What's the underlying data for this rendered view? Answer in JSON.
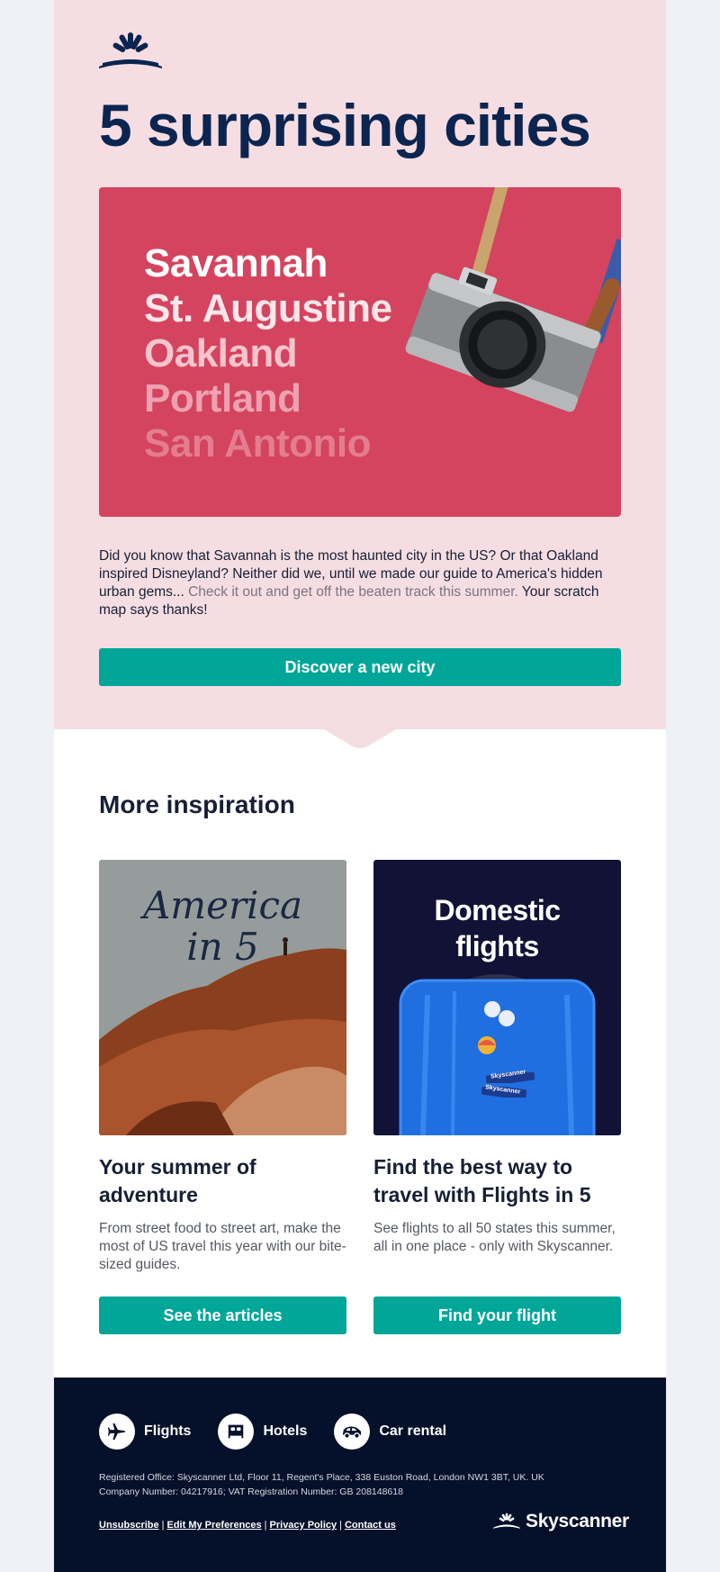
{
  "hero": {
    "headline": "5 surprising cities",
    "cities": [
      "Savannah",
      "St. Augustine",
      "Oakland",
      "Portland",
      "San Antonio"
    ],
    "body_main": "Did you know that Savannah is the most haunted city in the US? Or that Oakland inspired Disneyland? Neither did we, until we made our guide to America's hidden urban gems... ",
    "body_muted": "Check it out and get off the beaten track this summer.",
    "body_end": " Your scratch map says thanks!",
    "cta": "Discover a new city"
  },
  "inspiration": {
    "title": "More inspiration",
    "cards": [
      {
        "image_text_1": "America",
        "image_text_2": "in 5",
        "title": "Your summer of adventure",
        "description": "From street food to street art, make the most of US travel this year with our bite-sized guides.",
        "cta": "See the articles"
      },
      {
        "image_text_1": "Domestic",
        "image_text_2": "flights",
        "sticker_1": "Skyscanner",
        "sticker_2": "Skyscanner",
        "title": "Find the best way to travel with Flights in 5",
        "description": "See flights to all 50 states this summer, all in one place - only with Skyscanner.",
        "cta": "Find your flight"
      }
    ]
  },
  "footer": {
    "nav": [
      {
        "label": "Flights",
        "icon": "plane-icon"
      },
      {
        "label": "Hotels",
        "icon": "bed-icon"
      },
      {
        "label": "Car rental",
        "icon": "car-icon"
      }
    ],
    "legal_1": "Registered Office: Skyscanner Ltd, Floor 11, Regent's Place, 338 Euston Road, London NW1 3BT, UK. UK",
    "legal_2": "Company Number: 04217916; VAT Registration Number: GB 208148618",
    "links": [
      "Unsubscribe",
      "Edit My Preferences",
      "Privacy Policy",
      "Contact us"
    ],
    "brand": "Skyscanner"
  },
  "colors": {
    "hero_bg": "#f5dde2",
    "headline": "#0b2550",
    "hero_image_bg": "#d4445e",
    "accent_button": "#00a698",
    "footer_bg": "#05102a",
    "domestic_bg": "#111236"
  }
}
